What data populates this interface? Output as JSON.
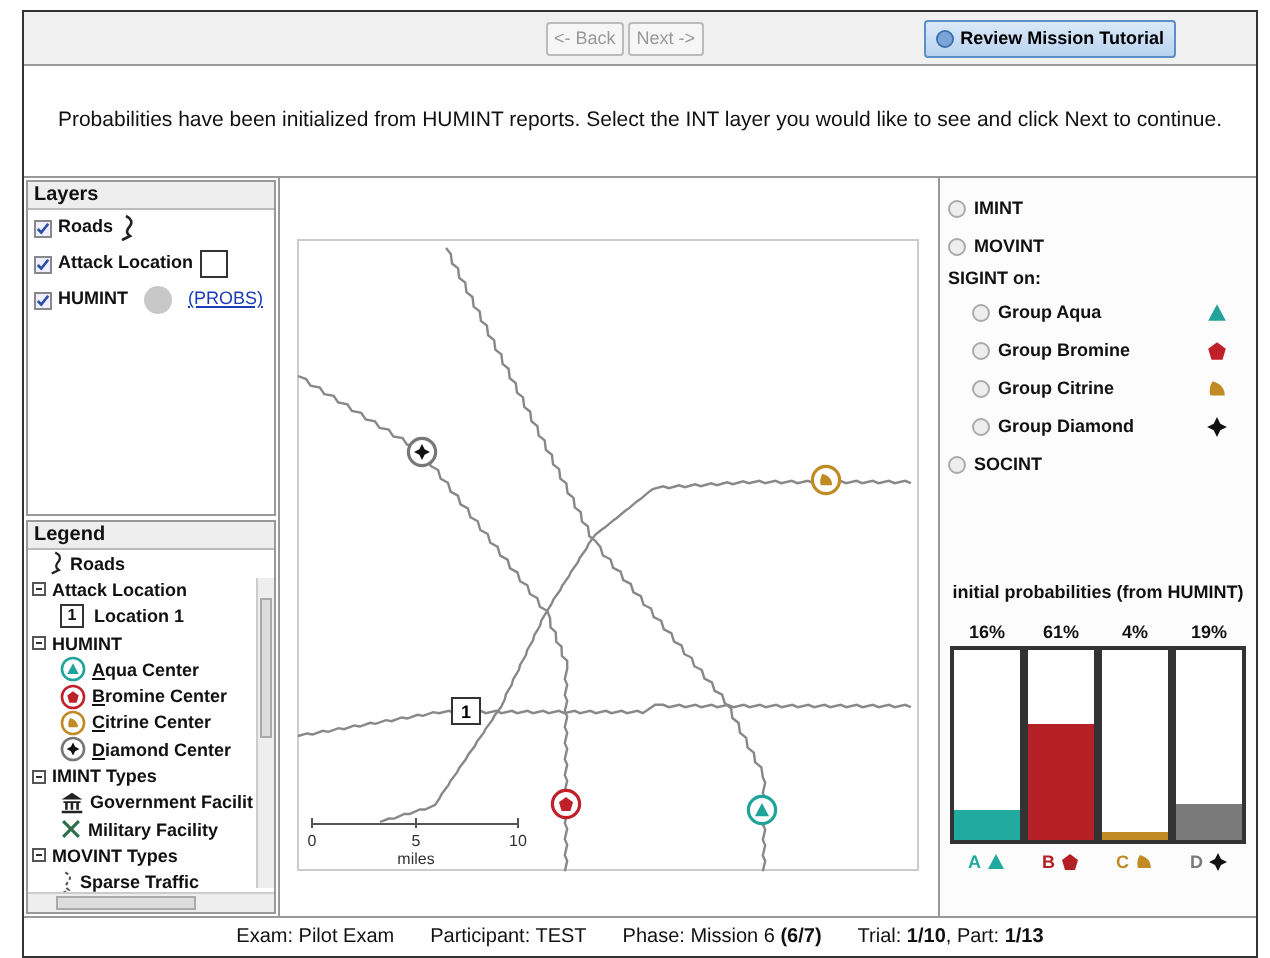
{
  "toolbar": {
    "back": {
      "label": "<- Back",
      "disabled": true
    },
    "next": {
      "label": "Next ->",
      "disabled": true
    },
    "tutorial": {
      "label": "Review Mission Tutorial"
    }
  },
  "instruction": "Probabilities have been initialized from HUMINT reports. Select the INT layer you would like to see and click Next to continue.",
  "layers": {
    "title": "Layers",
    "items": [
      {
        "label": "Roads",
        "checked": true,
        "kind": "road"
      },
      {
        "label": "Attack Location",
        "checked": true,
        "kind": "box"
      },
      {
        "label": "HUMINT",
        "checked": true,
        "kind": "circle",
        "link": "(PROBS)"
      }
    ]
  },
  "legend": {
    "title": "Legend",
    "items": [
      {
        "label": "Roads",
        "kind": "road"
      },
      {
        "label": "Attack Location",
        "expanded": true,
        "children": [
          {
            "label": "Location 1",
            "kind": "location",
            "number": "1"
          }
        ]
      },
      {
        "label": "HUMINT",
        "expanded": true,
        "children": [
          {
            "label": "Aqua Center",
            "kind": "aqua",
            "underline_first": true
          },
          {
            "label": "Bromine Center",
            "kind": "bromine",
            "underline_first": true
          },
          {
            "label": "Citrine Center",
            "kind": "citrine",
            "underline_first": true
          },
          {
            "label": "Diamond Center",
            "kind": "diamond",
            "underline_first": true
          }
        ]
      },
      {
        "label": "IMINT Types",
        "expanded": true,
        "children": [
          {
            "label": "Government Facilit",
            "kind": "government"
          },
          {
            "label": "Military Facility",
            "kind": "military"
          }
        ]
      },
      {
        "label": "MOVINT Types",
        "expanded": true,
        "children": [
          {
            "label": "Sparse Traffic",
            "kind": "traffic"
          }
        ]
      }
    ]
  },
  "map": {
    "location_label": "1",
    "scale": {
      "ticks": [
        "0",
        "5",
        "10"
      ],
      "unit": "miles"
    }
  },
  "int_options": [
    {
      "kind": "radio",
      "label": "IMINT",
      "selected": false
    },
    {
      "kind": "radio",
      "label": "MOVINT",
      "selected": false
    },
    {
      "kind": "heading",
      "label": "SIGINT on:"
    },
    {
      "kind": "group",
      "label": "Group Aqua",
      "selected": false,
      "marker": {
        "kind": "aqua",
        "color": "#1fa39a"
      }
    },
    {
      "kind": "group",
      "label": "Group Bromine",
      "selected": false,
      "marker": {
        "kind": "bromine",
        "color": "#c0202a"
      }
    },
    {
      "kind": "group",
      "label": "Group Citrine",
      "selected": false,
      "marker": {
        "kind": "citrine",
        "color": "#c08a24"
      }
    },
    {
      "kind": "group",
      "label": "Group Diamond",
      "selected": false,
      "marker": {
        "kind": "diamond",
        "color": "#111111"
      }
    },
    {
      "kind": "radio",
      "label": "SOCINT",
      "selected": false
    }
  ],
  "probabilities": {
    "title": "initial probabilities (from HUMINT)",
    "groups": [
      {
        "reading": "16%",
        "level": 0.16,
        "letter": "A",
        "kind": "aqua",
        "color": "#20aaa0"
      },
      {
        "reading": "61%",
        "level": 0.61,
        "letter": "B",
        "kind": "bromine",
        "color": "#b42025"
      },
      {
        "reading": "4%",
        "level": 0.04,
        "letter": "C",
        "kind": "citrine",
        "color": "#c08a24"
      },
      {
        "reading": "19%",
        "level": 0.19,
        "letter": "D",
        "kind": "diamond",
        "color": "#7a7a7a"
      }
    ]
  },
  "status_bar": [
    "Exam: Pilot Exam",
    "Participant: TEST",
    "Phase: Mission 6 **(6/7)**",
    "Trial: **1/10**, Part: **1/13**"
  ]
}
